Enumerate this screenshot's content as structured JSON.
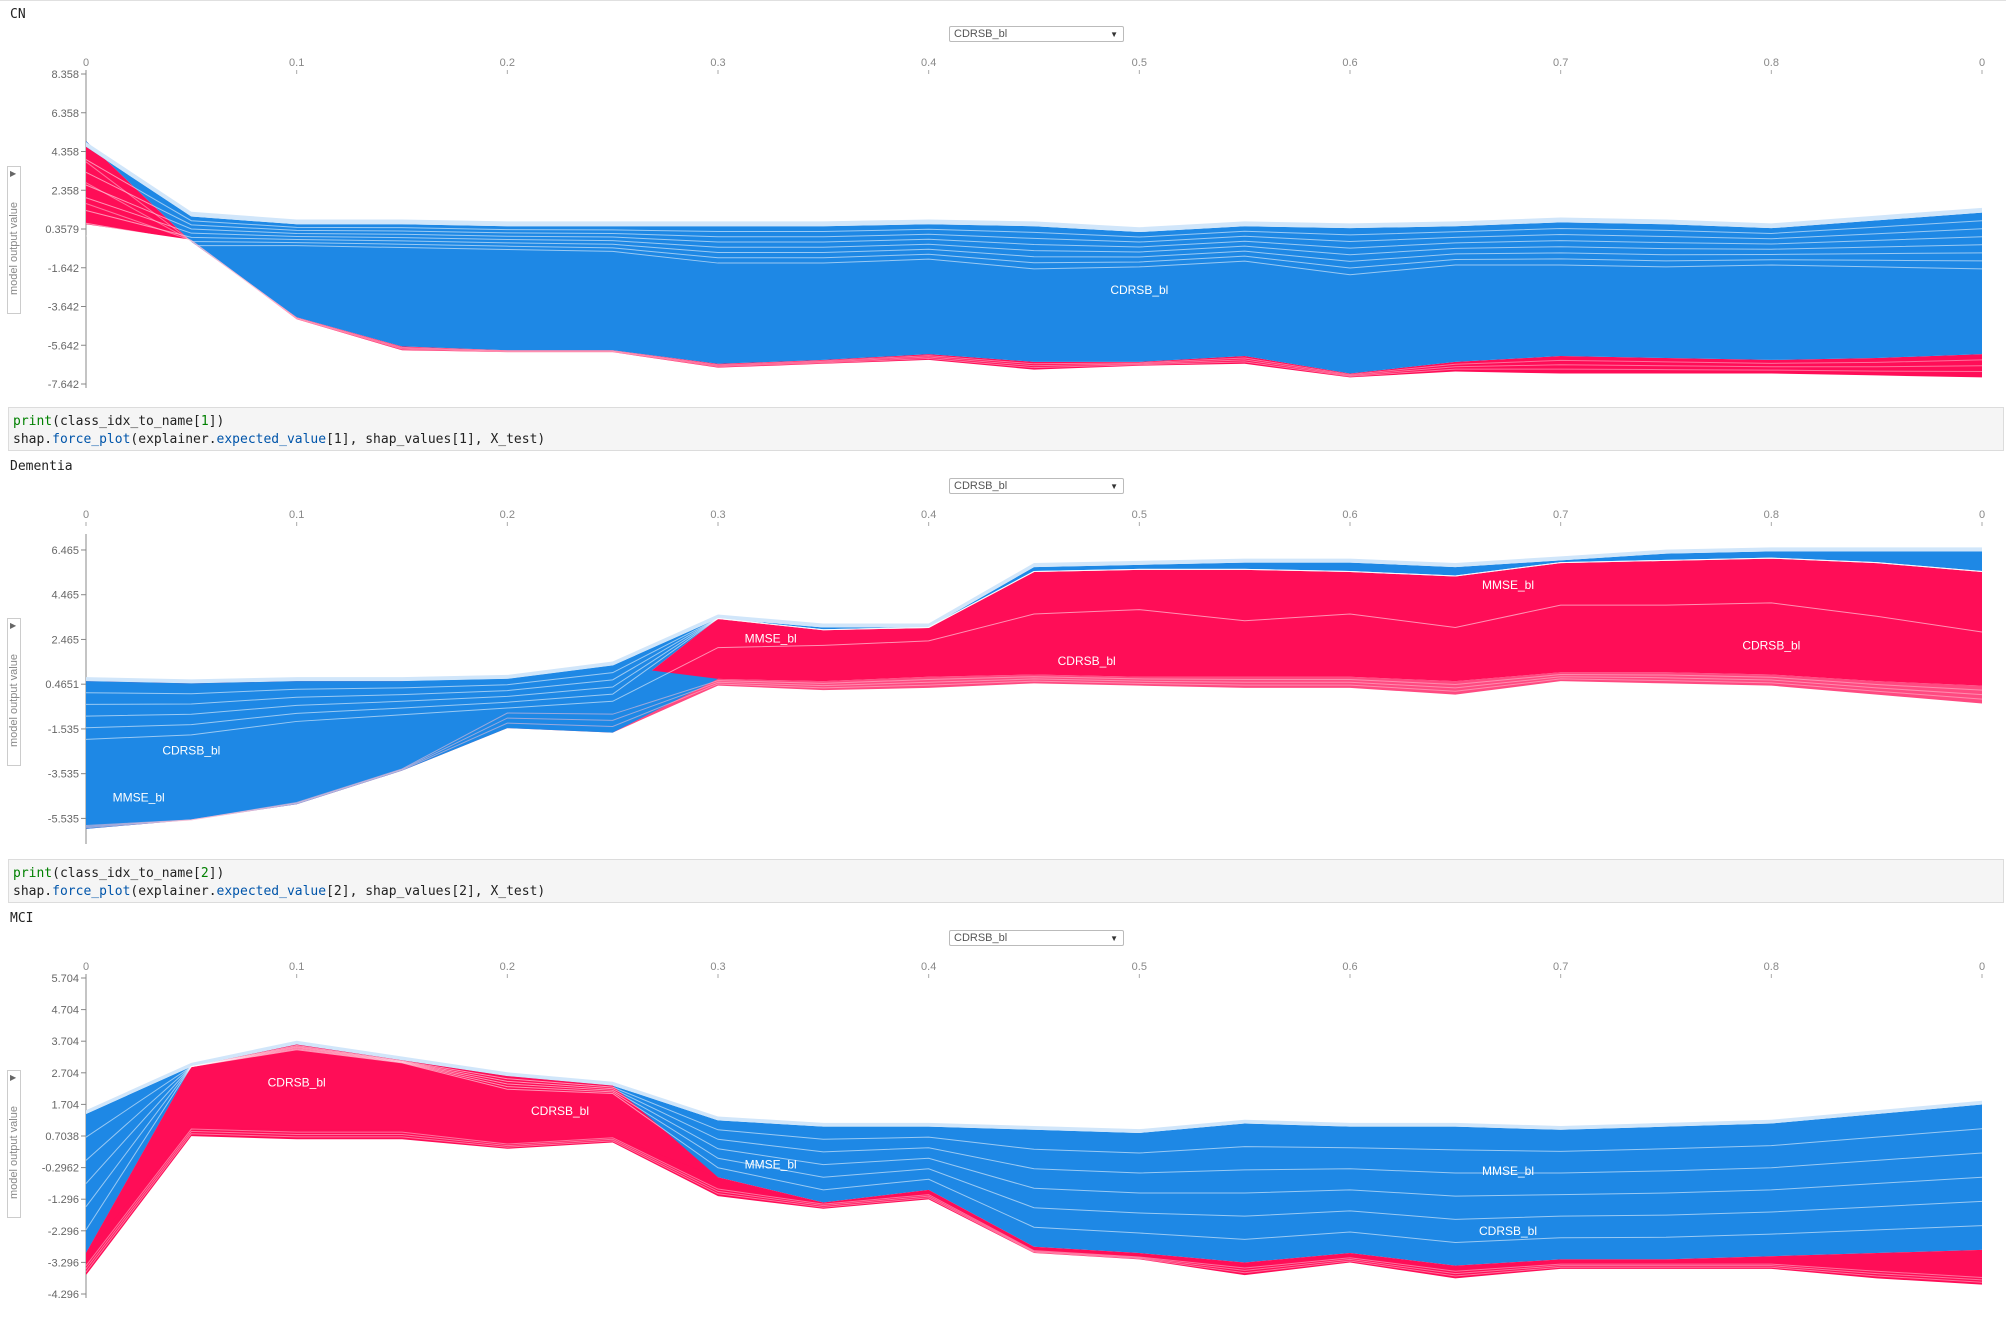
{
  "cells": [
    {
      "output_label": "CN",
      "code": null
    },
    {
      "output_label": "Dementia",
      "code": {
        "line1": [
          "print",
          "(class_idx_to_name[",
          "1",
          "])"
        ],
        "line2": [
          "shap.",
          "force_plot",
          "(explainer.",
          "expected_value",
          "[1], shap_values[1], X_test)"
        ]
      }
    },
    {
      "output_label": "MCI",
      "code": {
        "line1": [
          "print",
          "(class_idx_to_name[",
          "2",
          "])"
        ],
        "line2": [
          "shap.",
          "force_plot",
          "(explainer.",
          "expected_value",
          "[2], shap_values[2], X_test)"
        ]
      }
    }
  ],
  "ui": {
    "dropdown_value": "CDRSB_bl",
    "y_axis_label": "model output value"
  },
  "colors": {
    "positive": "#ff0d57",
    "negative": "#1e88e5",
    "pos_light": "#ffc3d5",
    "neg_light": "#d1e6fa"
  },
  "chart_data": [
    {
      "type": "area",
      "title": "CN",
      "xlabel": "",
      "ylabel": "model output value",
      "x_ticks": [
        "0",
        "0.1",
        "0.2",
        "0.3",
        "0.4",
        "0.5",
        "0.6",
        "0.7",
        "0.8",
        "0"
      ],
      "y_ticks": [
        "8.358",
        "6.358",
        "4.358",
        "2.358",
        "0.3579",
        "-1.642",
        "-3.642",
        "-5.642",
        "-7.642"
      ],
      "ylim": [
        -7.642,
        8.358
      ],
      "x": [
        0,
        0.05,
        0.1,
        0.15,
        0.2,
        0.25,
        0.3,
        0.35,
        0.4,
        0.45,
        0.5,
        0.55,
        0.6,
        0.65,
        0.7,
        0.75,
        0.8,
        0.85,
        0.9
      ],
      "series": [
        {
          "name": "upper_blue",
          "values": [
            4.6,
            1.0,
            0.6,
            0.6,
            0.5,
            0.5,
            0.5,
            0.5,
            0.6,
            0.5,
            0.2,
            0.5,
            0.4,
            0.5,
            0.7,
            0.6,
            0.4,
            0.8,
            1.2
          ]
        },
        {
          "name": "pos_blue_boundary",
          "values": [
            0.0,
            -0.5,
            -0.5,
            -0.6,
            -0.7,
            -0.8,
            -1.4,
            -1.4,
            -1.2,
            -1.7,
            -1.6,
            -1.3,
            -2.0,
            -1.5,
            -1.5,
            -1.6,
            -1.5,
            -1.6,
            -1.7
          ]
        },
        {
          "name": "red_top",
          "values": [
            4.9,
            -0.3,
            -4.2,
            -5.7,
            -5.9,
            -5.9,
            -6.6,
            -6.4,
            -6.1,
            -6.5,
            -6.5,
            -6.2,
            -7.1,
            -6.5,
            -6.2,
            -6.3,
            -6.4,
            -6.3,
            -6.1
          ]
        },
        {
          "name": "bottom",
          "values": [
            0.6,
            -0.2,
            -4.3,
            -5.9,
            -6.0,
            -6.0,
            -6.8,
            -6.6,
            -6.4,
            -6.9,
            -6.7,
            -6.6,
            -7.3,
            -7.0,
            -7.1,
            -7.1,
            -7.1,
            -7.2,
            -7.3
          ]
        }
      ],
      "labels": [
        {
          "text": "CDRSB_bl",
          "x": 0.5,
          "y": -2.8,
          "color": "white"
        }
      ]
    },
    {
      "type": "area",
      "title": "Dementia",
      "xlabel": "",
      "ylabel": "model output value",
      "x_ticks": [
        "0",
        "0.1",
        "0.2",
        "0.3",
        "0.4",
        "0.5",
        "0.6",
        "0.7",
        "0.8",
        "0"
      ],
      "y_ticks": [
        "6.465",
        "4.465",
        "2.465",
        "0.4651",
        "-1.535",
        "-3.535",
        "-5.535"
      ],
      "ylim": [
        -6.5,
        7.0
      ],
      "x": [
        0,
        0.05,
        0.1,
        0.15,
        0.2,
        0.25,
        0.3,
        0.35,
        0.4,
        0.45,
        0.5,
        0.55,
        0.6,
        0.65,
        0.7,
        0.75,
        0.8,
        0.85,
        0.9
      ],
      "series": [
        {
          "name": "top",
          "values": [
            0.6,
            0.5,
            0.6,
            0.6,
            0.7,
            1.3,
            3.4,
            3.0,
            3.0,
            5.7,
            5.8,
            5.9,
            5.9,
            5.7,
            6.0,
            6.3,
            6.4,
            6.4,
            6.4
          ]
        },
        {
          "name": "blue_red_boundary",
          "values": [
            0.6,
            0.5,
            0.6,
            0.6,
            -0.6,
            -0.3,
            3.4,
            2.9,
            3.0,
            5.5,
            5.6,
            5.6,
            5.5,
            5.3,
            5.9,
            6.0,
            6.1,
            5.9,
            5.5
          ]
        },
        {
          "name": "mmse_line",
          "values": [
            -2.0,
            -1.8,
            -1.2,
            -0.9,
            -0.6,
            -0.3,
            2.1,
            2.2,
            2.4,
            3.6,
            3.8,
            3.3,
            3.6,
            3.0,
            4.0,
            4.0,
            4.1,
            3.5,
            2.8
          ]
        },
        {
          "name": "red_lower",
          "values": [
            -5.8,
            -5.6,
            -4.8,
            -3.3,
            -0.6,
            -0.6,
            0.7,
            0.6,
            0.8,
            0.9,
            0.8,
            0.8,
            0.8,
            0.6,
            1.0,
            1.0,
            0.9,
            0.6,
            0.4
          ]
        },
        {
          "name": "bottom",
          "values": [
            -6.0,
            -5.6,
            -4.9,
            -3.4,
            -1.5,
            -1.7,
            0.4,
            0.2,
            0.3,
            0.5,
            0.4,
            0.3,
            0.3,
            0.0,
            0.6,
            0.5,
            0.4,
            0.0,
            -0.4
          ]
        }
      ],
      "labels": [
        {
          "text": "MMSE_bl",
          "x": 0.325,
          "y": 2.5,
          "color": "white"
        },
        {
          "text": "CDRSB_bl",
          "x": 0.475,
          "y": 1.5,
          "color": "white"
        },
        {
          "text": "MMSE_bl",
          "x": 0.675,
          "y": 4.9,
          "color": "white"
        },
        {
          "text": "CDRSB_bl",
          "x": 0.8,
          "y": 2.2,
          "color": "white"
        },
        {
          "text": "CDRSB_bl",
          "x": 0.05,
          "y": -2.5,
          "color": "white"
        },
        {
          "text": "MMSE_bl",
          "x": 0.025,
          "y": -4.6,
          "color": "white"
        }
      ]
    },
    {
      "type": "area",
      "title": "MCI",
      "xlabel": "",
      "ylabel": "model output value",
      "x_ticks": [
        "0",
        "0.1",
        "0.2",
        "0.3",
        "0.4",
        "0.5",
        "0.6",
        "0.7",
        "0.8",
        "0"
      ],
      "y_ticks": [
        "5.704",
        "4.704",
        "3.704",
        "2.704",
        "1.704",
        "0.7038",
        "-0.2962",
        "-1.296",
        "-2.296",
        "-3.296",
        "-4.296"
      ],
      "ylim": [
        -4.296,
        5.704
      ],
      "x": [
        0,
        0.05,
        0.1,
        0.15,
        0.2,
        0.25,
        0.3,
        0.35,
        0.4,
        0.45,
        0.5,
        0.55,
        0.6,
        0.65,
        0.7,
        0.75,
        0.8,
        0.85,
        0.9
      ],
      "series": [
        {
          "name": "top",
          "values": [
            1.4,
            2.9,
            3.6,
            3.1,
            2.6,
            2.3,
            1.2,
            1.0,
            1.0,
            0.9,
            0.8,
            1.1,
            1.0,
            1.0,
            0.9,
            1.0,
            1.1,
            1.4,
            1.7
          ]
        },
        {
          "name": "red_blue_boundary",
          "values": [
            -3.0,
            2.9,
            3.4,
            3.0,
            2.1,
            2.0,
            -0.6,
            -1.4,
            -1.0,
            -2.8,
            -3.0,
            -3.3,
            -3.0,
            -3.4,
            -3.2,
            -3.2,
            -3.1,
            -3.0,
            -2.9
          ]
        },
        {
          "name": "lower_red_band",
          "values": [
            -3.3,
            1.0,
            0.9,
            0.9,
            0.5,
            0.7,
            -0.9,
            -1.4,
            -1.1,
            -2.9,
            -3.1,
            -3.4,
            -3.1,
            -3.5,
            -3.3,
            -3.3,
            -3.3,
            -3.5,
            -3.7
          ]
        },
        {
          "name": "bottom",
          "values": [
            -3.7,
            0.7,
            0.6,
            0.6,
            0.3,
            0.5,
            -1.2,
            -1.6,
            -1.3,
            -3.0,
            -3.2,
            -3.7,
            -3.3,
            -3.8,
            -3.5,
            -3.5,
            -3.5,
            -3.8,
            -4.0
          ]
        }
      ],
      "labels": [
        {
          "text": "CDRSB_bl",
          "x": 0.1,
          "y": 2.4,
          "color": "white"
        },
        {
          "text": "CDRSB_bl",
          "x": 0.225,
          "y": 1.5,
          "color": "white"
        },
        {
          "text": "MMSE_bl",
          "x": 0.325,
          "y": -0.2,
          "color": "white"
        },
        {
          "text": "MMSE_bl",
          "x": 0.675,
          "y": -0.4,
          "color": "white"
        },
        {
          "text": "CDRSB_bl",
          "x": 0.675,
          "y": -2.3,
          "color": "white"
        }
      ]
    }
  ]
}
